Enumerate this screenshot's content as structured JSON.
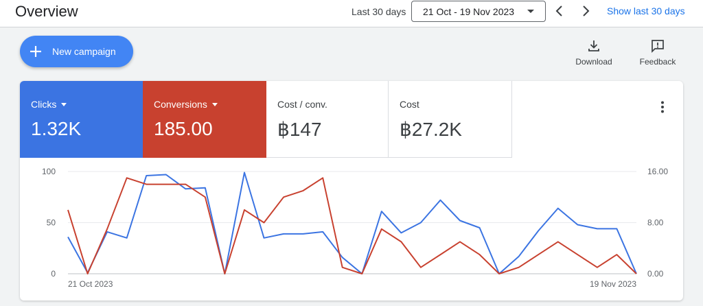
{
  "header": {
    "title": "Overview",
    "range_label": "Last 30 days",
    "date_range": "21 Oct - 19 Nov 2023",
    "show_last": "Show last 30 days"
  },
  "actions": {
    "new_campaign": "New campaign",
    "download": "Download",
    "feedback": "Feedback"
  },
  "metrics": [
    {
      "label": "Clicks",
      "value": "1.32K",
      "color": "#3b74e2"
    },
    {
      "label": "Conversions",
      "value": "185.00",
      "color": "#c8412f"
    },
    {
      "label": "Cost / conv.",
      "value": "฿147"
    },
    {
      "label": "Cost",
      "value": "฿27.2K"
    }
  ],
  "chart_data": {
    "type": "line",
    "x_ticks": [
      "21 Oct 2023",
      "19 Nov 2023"
    ],
    "left_axis": {
      "ticks": [
        "0",
        "50",
        "100"
      ],
      "ylim": [
        0,
        100
      ]
    },
    "right_axis": {
      "ticks": [
        "0.00",
        "8.00",
        "16.00"
      ],
      "ylim": [
        0,
        16
      ]
    },
    "grid": true,
    "series": [
      {
        "name": "Clicks",
        "axis": "left",
        "color": "#3b74e2",
        "values": [
          36,
          1,
          41,
          35,
          96,
          97,
          83,
          84,
          0,
          99,
          35,
          39,
          39,
          41,
          16,
          0,
          61,
          40,
          50,
          72,
          52,
          45,
          0,
          17,
          42,
          64,
          48,
          44,
          44,
          0
        ]
      },
      {
        "name": "Conversions",
        "axis": "right",
        "color": "#c8412f",
        "values": [
          10,
          0,
          7,
          15,
          14,
          14,
          14,
          12,
          0,
          10,
          8,
          12,
          13,
          15,
          1,
          0,
          7,
          5,
          1,
          3,
          5,
          3,
          0,
          1,
          3,
          5,
          3,
          1,
          3,
          0
        ]
      }
    ]
  }
}
